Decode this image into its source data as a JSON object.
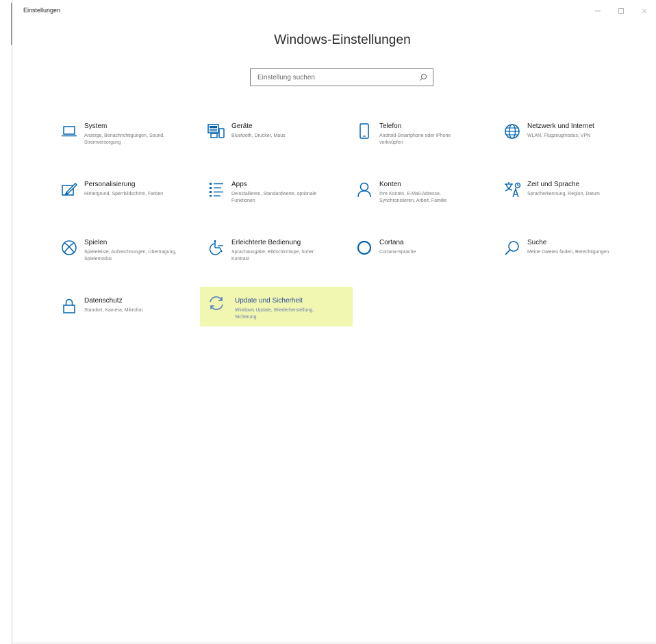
{
  "window": {
    "title": "Einstellungen"
  },
  "page": {
    "heading": "Windows-Einstellungen"
  },
  "search": {
    "placeholder": "Einstellung suchen",
    "value": ""
  },
  "colors": {
    "accent": "#0063b1",
    "highlight": "#f1f7b0"
  },
  "tiles": [
    {
      "title": "System",
      "desc": "Anzeige, Benachrichtigungen, Sound, Stromversorgung",
      "icon": "laptop-icon"
    },
    {
      "title": "Geräte",
      "desc": "Bluetooth, Drucker, Maus",
      "icon": "devices-icon"
    },
    {
      "title": "Telefon",
      "desc": "Android-Smartphone oder iPhone verknüpfen",
      "icon": "phone-icon"
    },
    {
      "title": "Netzwerk und Internet",
      "desc": "WLAN, Flugzeugmodus, VPN",
      "icon": "globe-icon"
    },
    {
      "title": "Personalisierung",
      "desc": "Hintergrund, Sperrbildschirm, Farben",
      "icon": "paintbrush-icon"
    },
    {
      "title": "Apps",
      "desc": "Deinstallieren, Standardwerte, optionale Funktionen",
      "icon": "apps-list-icon"
    },
    {
      "title": "Konten",
      "desc": "Ihre Konten, E-Mail-Adresse, Synchronisieren, Arbeit, Familie",
      "icon": "person-icon"
    },
    {
      "title": "Zeit und Sprache",
      "desc": "Spracherkennung, Region, Datum",
      "icon": "language-icon"
    },
    {
      "title": "Spielen",
      "desc": "Spieleleiste, Aufzeichnungen, Übertragung, Spielemodus",
      "icon": "xbox-icon"
    },
    {
      "title": "Erleichterte Bedienung",
      "desc": "Sprachausgabe, Bildschirmlupe, hoher Kontrast",
      "icon": "ease-of-access-icon"
    },
    {
      "title": "Cortana",
      "desc": "Cortana-Sprache",
      "icon": "cortana-icon"
    },
    {
      "title": "Suche",
      "desc": "Meine Dateien finden, Berechtigungen",
      "icon": "search-icon"
    },
    {
      "title": "Datenschutz",
      "desc": "Standort, Kamera, Mikrofon",
      "icon": "lock-icon"
    },
    {
      "title": "Update und Sicherheit",
      "desc": "Windows Update, Wiederherstellung, Sicherung",
      "icon": "sync-icon",
      "highlighted": true
    }
  ]
}
